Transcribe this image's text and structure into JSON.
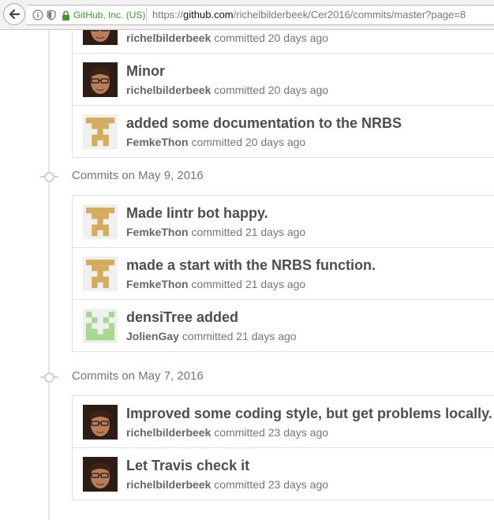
{
  "browser": {
    "site_identity": "GitHub, Inc. (US)",
    "url_prefix": "https://",
    "url_domain": "github.com",
    "url_path": "/richelbilderbeek/Cer2016/commits/master?page=8"
  },
  "commits_verb": "committed",
  "groups": [
    {
      "header": "",
      "commits": [
        {
          "message": "",
          "author": "richelbilderbeek",
          "time": "20 days ago",
          "avatar": "photo"
        },
        {
          "message": "Minor",
          "author": "richelbilderbeek",
          "time": "20 days ago",
          "avatar": "photo"
        },
        {
          "message": "added some documentation to the NRBS",
          "author": "FemkeThon",
          "time": "20 days ago",
          "avatar": "identicon-gold"
        }
      ]
    },
    {
      "header": "Commits on May 9, 2016",
      "commits": [
        {
          "message": "Made lintr bot happy.",
          "author": "FemkeThon",
          "time": "21 days ago",
          "avatar": "identicon-gold"
        },
        {
          "message": "made a start with the NRBS function.",
          "author": "FemkeThon",
          "time": "21 days ago",
          "avatar": "identicon-gold"
        },
        {
          "message": "densiTree added",
          "author": "JolienGay",
          "time": "21 days ago",
          "avatar": "identicon-green"
        }
      ]
    },
    {
      "header": "Commits on May 7, 2016",
      "commits": [
        {
          "message": "Improved some coding style, but get problems locally.",
          "author": "richelbilderbeek",
          "time": "23 days ago",
          "avatar": "photo"
        },
        {
          "message": "Let Travis check it",
          "author": "richelbilderbeek",
          "time": "23 days ago",
          "avatar": "photo"
        }
      ]
    }
  ],
  "colors": {
    "identicon_gold": "#d4ac5e",
    "identicon_green": "#a6d98e",
    "identicon_bg": "#f0f0f0"
  },
  "icons": [
    "back-arrow-icon",
    "info-icon",
    "tracking-shield-icon",
    "lock-icon",
    "commit-dot-icon"
  ]
}
